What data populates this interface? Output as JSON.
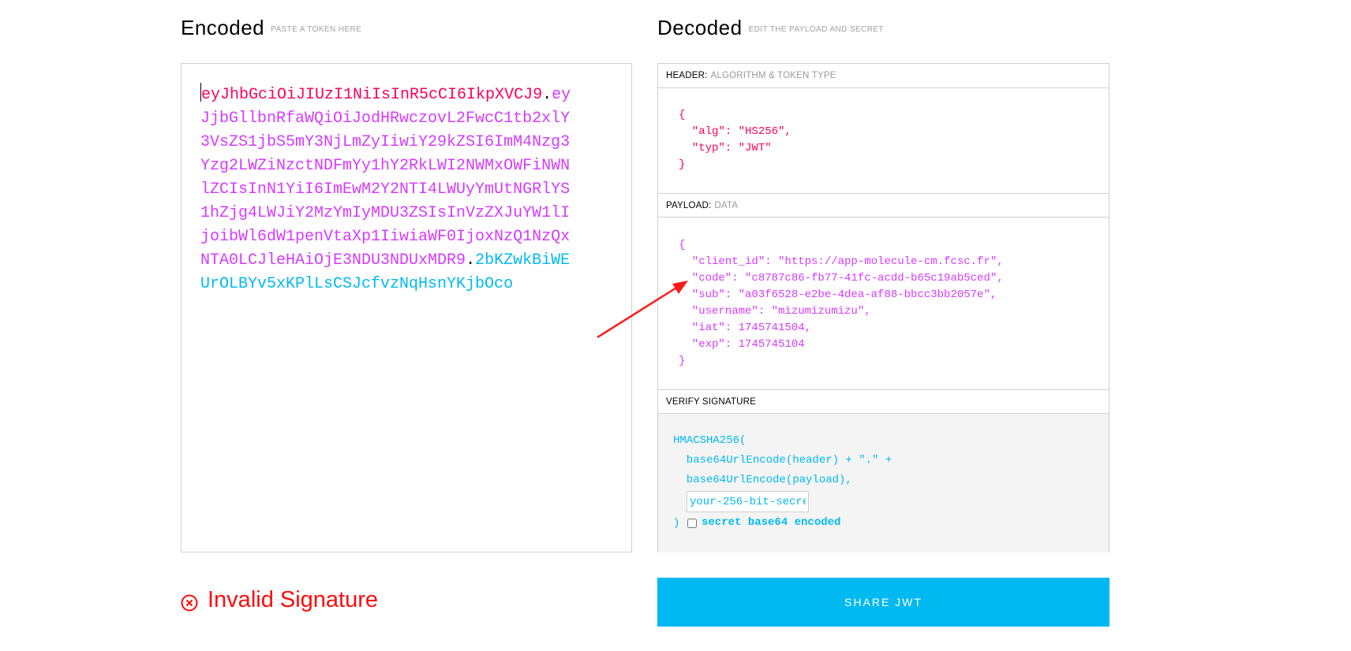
{
  "encoded": {
    "title": "Encoded",
    "subtitle": "PASTE A TOKEN HERE",
    "token_header": "eyJhbGciOiJIUzI1NiIsInR5cCI6IkpXVCJ9",
    "token_payload": "eyJjbGllbnRfaWQiOiJodHRwczovL2FwcC1tb2xlY3VsZS1jbS5mY3NjLmZyIiwiY29kZSI6ImM4Nzg3Yzg2LWZiNzctNDFmYy1hY2RkLWI2NWMxOWFiNWNlZCIsInN1YiI6ImEwM2Y2NTI4LWUyYmUtNGRlYS1hZjg4LWJiY2MzYmIyMDU3ZSIsInVzZXJuYW1lIjoibWl6dW1penVtaXp1IiwiaWF0IjoxNzQ1NzQxNTA0LCJleHAiOjE3NDU3NDUxMDR9",
    "token_signature": "2bKZwkBiWEUrOLBYv5xKPlLsCSJcfvzNqHsnYKjbOco",
    "dot": "."
  },
  "decoded": {
    "title": "Decoded",
    "subtitle": "EDIT THE PAYLOAD AND SECRET",
    "header_label": "HEADER:",
    "header_desc": "ALGORITHM & TOKEN TYPE",
    "header_json": "{\n  \"alg\": \"HS256\",\n  \"typ\": \"JWT\"\n}",
    "payload_label": "PAYLOAD:",
    "payload_desc": "DATA",
    "payload_json": "{\n  \"client_id\": \"https://app-molecule-cm.fcsc.fr\",\n  \"code\": \"c8787c86-fb77-41fc-acdd-b65c19ab5ced\",\n  \"sub\": \"a03f6528-e2be-4dea-af88-bbcc3bb2057e\",\n  \"username\": \"mizumizumizu\",\n  \"iat\": 1745741504,\n  \"exp\": 1745745104\n}",
    "verify_label": "VERIFY SIGNATURE",
    "verify_line1": "HMACSHA256(",
    "verify_line2": "  base64UrlEncode(header) + \".\" +",
    "verify_line3": "  base64UrlEncode(payload),",
    "secret_placeholder": "your-256-bit-secret",
    "verify_close": ")",
    "checkbox_label": "secret base64 encoded"
  },
  "status": {
    "invalid_text": "Invalid Signature",
    "icon": "x-circle-icon"
  },
  "share_label": "SHARE JWT",
  "colors": {
    "header": "#fb015b",
    "payload": "#d63aff",
    "signature": "#00b9f1",
    "error": "#fb0c0c",
    "annotation_arrow": "#ff1a1a"
  }
}
